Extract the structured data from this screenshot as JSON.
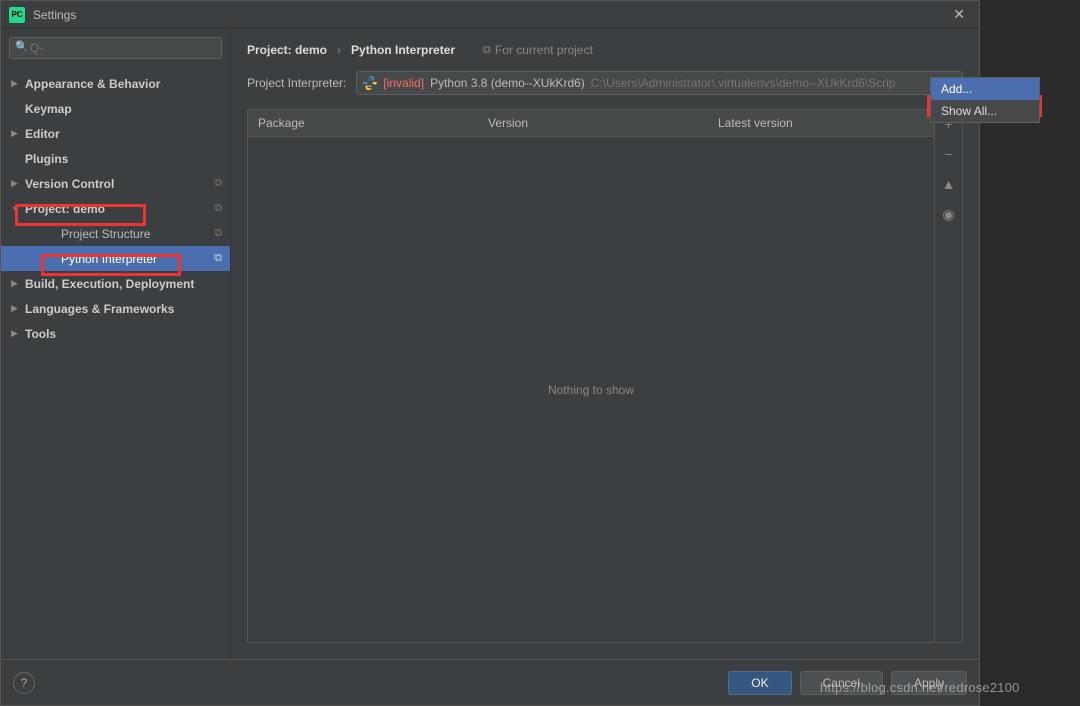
{
  "titlebar": {
    "app_icon_text": "PC",
    "title": "Settings"
  },
  "search": {
    "placeholder": "Q-"
  },
  "sidebar": {
    "items": [
      {
        "label": "Appearance & Behavior",
        "expandable": true,
        "expanded": false,
        "bold": true,
        "level": 0
      },
      {
        "label": "Keymap",
        "expandable": false,
        "bold": true,
        "level": 0
      },
      {
        "label": "Editor",
        "expandable": true,
        "expanded": false,
        "bold": true,
        "level": 0
      },
      {
        "label": "Plugins",
        "expandable": false,
        "bold": true,
        "level": 0
      },
      {
        "label": "Version Control",
        "expandable": true,
        "expanded": false,
        "bold": true,
        "level": 0,
        "copy": true
      },
      {
        "label": "Project: demo",
        "expandable": true,
        "expanded": true,
        "bold": true,
        "level": 0,
        "copy": true
      },
      {
        "label": "Project Structure",
        "expandable": false,
        "bold": false,
        "level": 2,
        "copy": true
      },
      {
        "label": "Python Interpreter",
        "expandable": false,
        "bold": false,
        "level": 2,
        "copy": true,
        "selected": true
      },
      {
        "label": "Build, Execution, Deployment",
        "expandable": true,
        "expanded": false,
        "bold": true,
        "level": 0
      },
      {
        "label": "Languages & Frameworks",
        "expandable": true,
        "expanded": false,
        "bold": true,
        "level": 0
      },
      {
        "label": "Tools",
        "expandable": true,
        "expanded": false,
        "bold": true,
        "level": 0
      }
    ]
  },
  "breadcrumb": {
    "project": "Project: demo",
    "page": "Python Interpreter",
    "for_current": "For current project"
  },
  "interpreter": {
    "label": "Project Interpreter:",
    "invalid_tag": "[invalid]",
    "name": "Python 3.8 (demo--XUkKrd6)",
    "path": "C:\\Users\\Administrator\\.virtualenvs\\demo--XUkKrd6\\Scrip"
  },
  "table": {
    "headers": {
      "package": "Package",
      "version": "Version",
      "latest": "Latest version"
    },
    "empty_text": "Nothing to show"
  },
  "dropdown": {
    "add": "Add...",
    "show_all": "Show All..."
  },
  "footer": {
    "ok": "OK",
    "cancel": "Cancel",
    "apply": "Apply",
    "help": "?"
  },
  "watermark": "https://blog.csdn.net/redrose2100"
}
